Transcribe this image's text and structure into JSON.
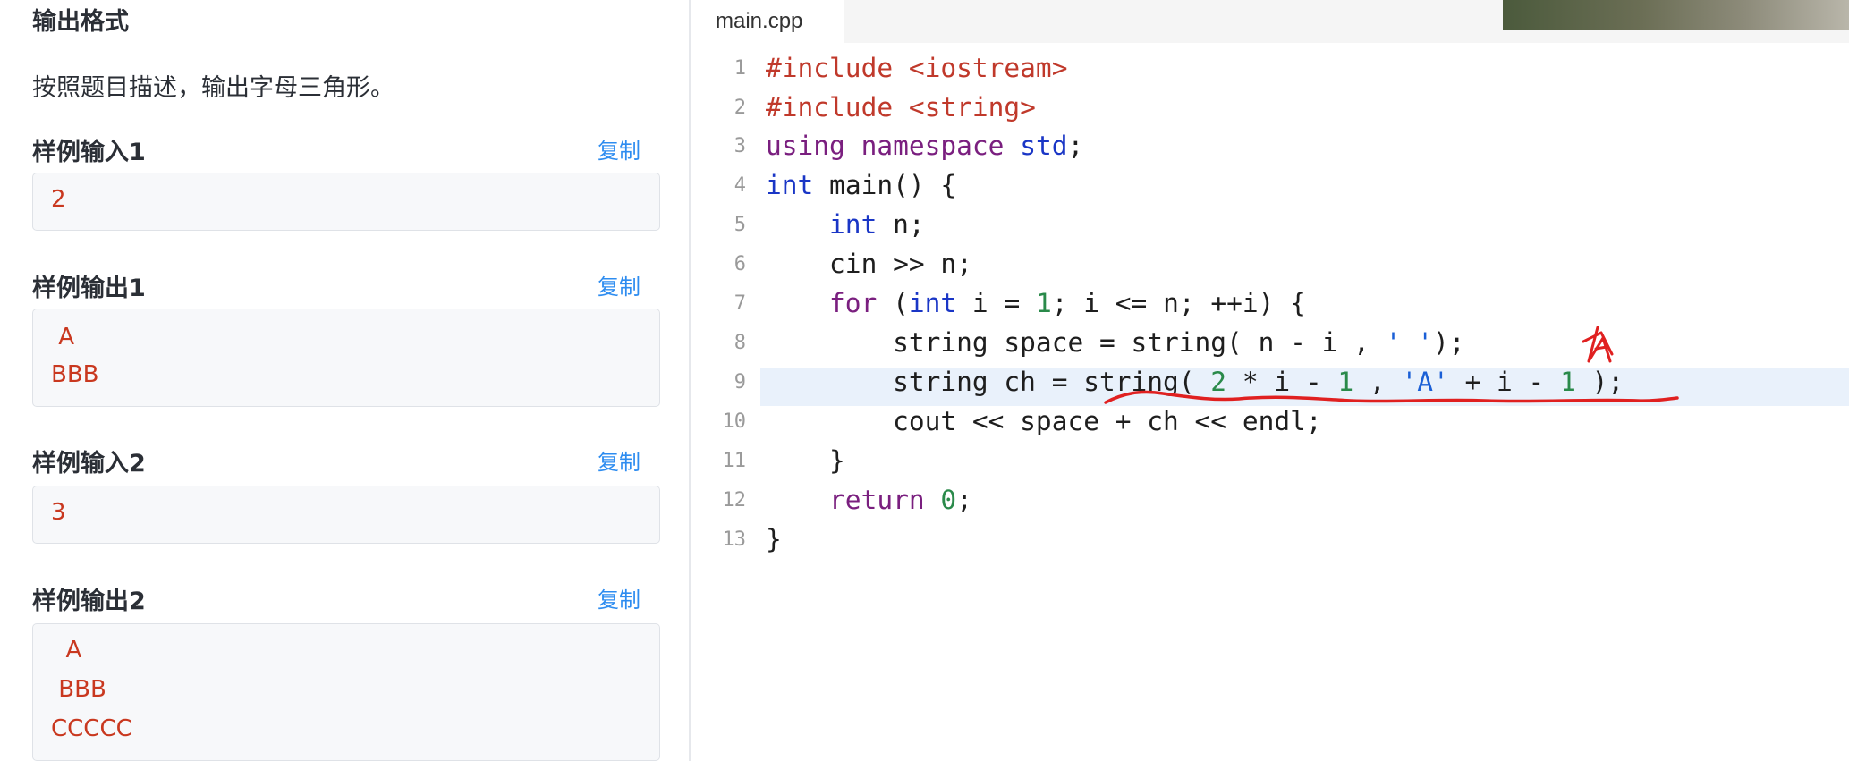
{
  "problem": {
    "output_format_title": "输出格式",
    "output_format_desc": "按照题目描述，输出字母三角形。",
    "samples": [
      {
        "title": "样例输入1",
        "copy_label": "复制",
        "lines": [
          "2"
        ]
      },
      {
        "title": "样例输出1",
        "copy_label": "复制",
        "lines": [
          " A",
          "BBB"
        ]
      },
      {
        "title": "样例输入2",
        "copy_label": "复制",
        "lines": [
          "3"
        ]
      },
      {
        "title": "样例输出2",
        "copy_label": "复制",
        "lines": [
          "  A",
          " BBB",
          "CCCCC"
        ]
      }
    ]
  },
  "editor": {
    "tab_label": "main.cpp",
    "highlighted_line": 9,
    "line_numbers": [
      "1",
      "2",
      "3",
      "4",
      "5",
      "6",
      "7",
      "8",
      "9",
      "10",
      "11",
      "12",
      "13"
    ],
    "code": [
      "#include <iostream>",
      "#include <string>",
      "using namespace std;",
      "int main() {",
      "    int n;",
      "    cin >> n;",
      "    for (int i = 1; i <= n; ++i) {",
      "        string space = string( n - i , ' ');",
      "        string ch = string( 2 * i - 1 , 'A' + i - 1 );",
      "        cout << space + ch << endl;",
      "    }",
      "    return 0;",
      "}"
    ]
  },
  "colors": {
    "keyword": "#7a1f7f",
    "type": "#1a36c6",
    "preprocessor": "#c0392b",
    "number": "#2a8a4a",
    "char_literal": "#1a5fd6",
    "copy_link": "#2d8cf0",
    "sample_text": "#c9381f",
    "annotation": "#e02020"
  },
  "icons": {
    "annotation_mark": "hand-drawn-underline-and-arrow"
  }
}
